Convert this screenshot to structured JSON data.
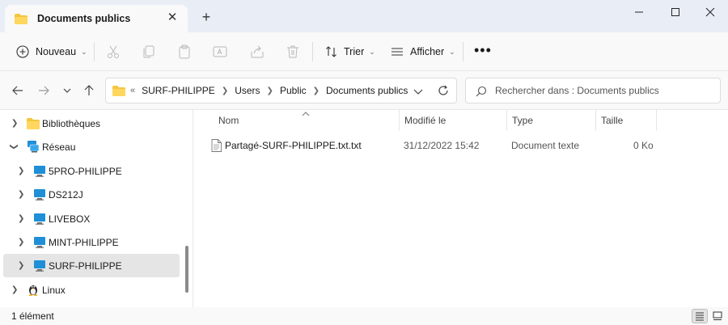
{
  "tab": {
    "title": "Documents publics"
  },
  "toolbar": {
    "new_label": "Nouveau",
    "sort_label": "Trier",
    "view_label": "Afficher"
  },
  "address": {
    "overflow": "«",
    "crumbs": [
      "SURF-PHILIPPE",
      "Users",
      "Public",
      "Documents publics"
    ]
  },
  "search": {
    "placeholder": "Rechercher dans : Documents publics"
  },
  "nav": {
    "items": [
      "Bibliothèques",
      "Réseau",
      "5PRO-PHILIPPE",
      "DS212J",
      "LIVEBOX",
      "MINT-PHILIPPE",
      "SURF-PHILIPPE",
      "Linux"
    ]
  },
  "columns": {
    "name": "Nom",
    "modified": "Modifié le",
    "type": "Type",
    "size": "Taille"
  },
  "files": [
    {
      "name": "Partagé-SURF-PHILIPPE.txt.txt",
      "modified": "31/12/2022 15:42",
      "type": "Document texte",
      "size": "0 Ko"
    }
  ],
  "status": {
    "count": "1 élément"
  },
  "colors": {
    "accent": "#0067c0",
    "folder": "#f4c63d",
    "monitor": "#1f8fd8",
    "selected_bg": "#e5e5e5",
    "tab_strip": "#e9eef6"
  }
}
